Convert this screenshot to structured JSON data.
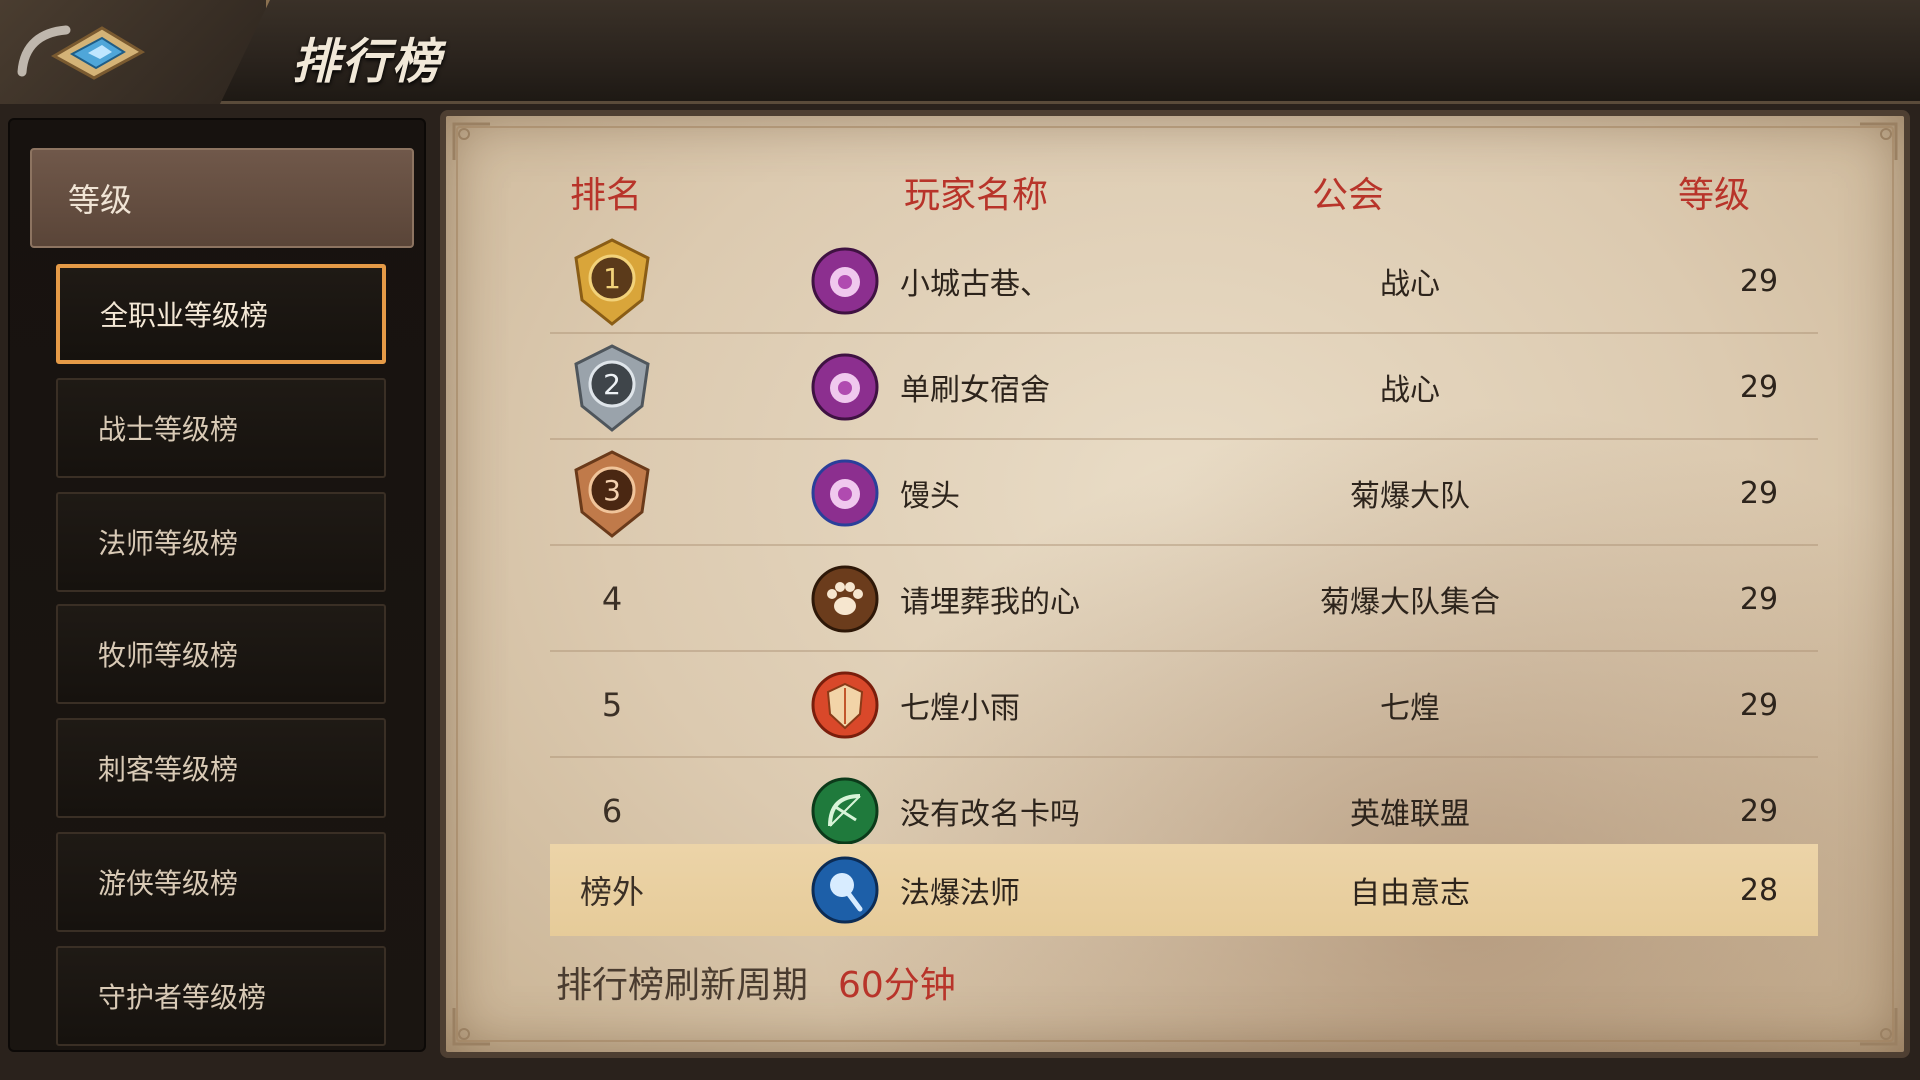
{
  "header": {
    "title": "排行榜",
    "back_icon": "back-arrow-icon"
  },
  "sidebar": {
    "category": "等级",
    "items": [
      {
        "label": "全职业等级榜",
        "active": true
      },
      {
        "label": "战士等级榜",
        "active": false
      },
      {
        "label": "法师等级榜",
        "active": false
      },
      {
        "label": "牧师等级榜",
        "active": false
      },
      {
        "label": "刺客等级榜",
        "active": false
      },
      {
        "label": "游侠等级榜",
        "active": false
      },
      {
        "label": "守护者等级榜",
        "active": false
      }
    ]
  },
  "table": {
    "columns": {
      "rank": "排名",
      "player": "玩家名称",
      "guild": "公会",
      "level": "等级"
    },
    "rows": [
      {
        "rank": "1",
        "badge": "gold",
        "name": "小城古巷、",
        "guild": "战心",
        "level": "29",
        "class_icon": "mage-rose-icon"
      },
      {
        "rank": "2",
        "badge": "silver",
        "name": "单刷女宿舍",
        "guild": "战心",
        "level": "29",
        "class_icon": "mage-rose-icon"
      },
      {
        "rank": "3",
        "badge": "bronze",
        "name": "馒头",
        "guild": "菊爆大队",
        "level": "29",
        "class_icon": "mage-rose-icon"
      },
      {
        "rank": "4",
        "badge": "",
        "name": "请埋葬我的心",
        "guild": "菊爆大队集合",
        "level": "29",
        "class_icon": "paw-icon"
      },
      {
        "rank": "5",
        "badge": "",
        "name": "七煌小雨",
        "guild": "七煌",
        "level": "29",
        "class_icon": "shield-icon"
      },
      {
        "rank": "6",
        "badge": "",
        "name": "没有改名卡吗",
        "guild": "英雄联盟",
        "level": "29",
        "class_icon": "bow-icon"
      }
    ],
    "self_row": {
      "rank": "榜外",
      "name": "法爆法师",
      "guild": "自由意志",
      "level": "28",
      "class_icon": "staff-orb-icon"
    }
  },
  "footer": {
    "label": "排行榜刷新周期",
    "value": "60分钟"
  },
  "colors": {
    "accent_red": "#b8342a",
    "active_border": "#e59a47",
    "gold": "#d9a53a",
    "silver": "#9aa3ab",
    "bronze": "#c07a4a"
  }
}
